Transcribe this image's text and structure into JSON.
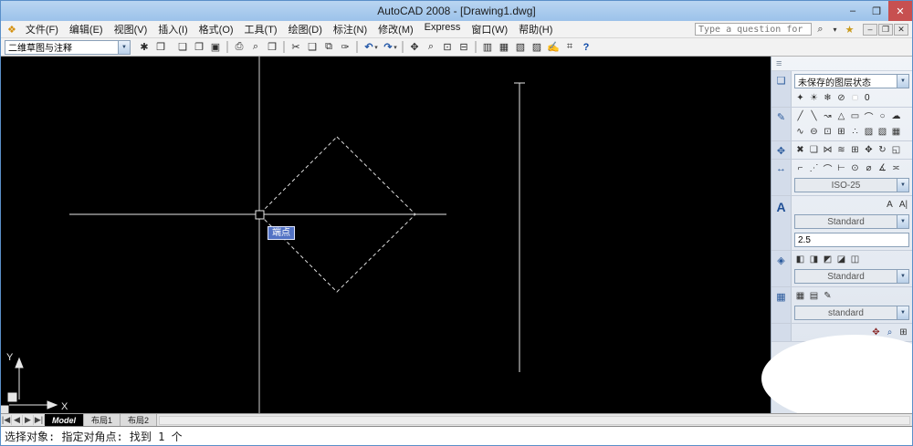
{
  "ui": {
    "caret": "▼",
    "accent_blue": "#9cc2ea",
    "canvas_black": "#000000",
    "tooltip_blue": "#5272c4"
  },
  "window": {
    "title": "AutoCAD 2008 - [Drawing1.dwg]",
    "minimize": "–",
    "restore": "❐",
    "close": "✕"
  },
  "menubar": {
    "acad_icon": "❖",
    "menus": [
      {
        "name": "menu-file",
        "label": "文件(F)"
      },
      {
        "name": "menu-edit",
        "label": "编辑(E)"
      },
      {
        "name": "menu-view",
        "label": "视图(V)"
      },
      {
        "name": "menu-insert",
        "label": "插入(I)"
      },
      {
        "name": "menu-format",
        "label": "格式(O)"
      },
      {
        "name": "menu-tools",
        "label": "工具(T)"
      },
      {
        "name": "menu-draw",
        "label": "绘图(D)"
      },
      {
        "name": "menu-dimension",
        "label": "标注(N)"
      },
      {
        "name": "menu-modify",
        "label": "修改(M)"
      },
      {
        "name": "menu-express",
        "label": "Express"
      },
      {
        "name": "menu-window",
        "label": "窗口(W)"
      },
      {
        "name": "menu-help",
        "label": "帮助(H)"
      }
    ],
    "help_search": {
      "value": "Type a question for help"
    },
    "search_icon": "⌕",
    "search_caret": "▾",
    "star_icon": "★",
    "child_minimize": "–",
    "child_restore": "❐",
    "child_close": "✕"
  },
  "toolbar": {
    "workspace": {
      "value": "二维草图与注释"
    },
    "workspace_icons": [
      {
        "name": "workspace-settings-icon",
        "glyph": "✱"
      },
      {
        "name": "workspace-save-icon",
        "glyph": "❒"
      }
    ],
    "icons": [
      {
        "name": "new-file-icon",
        "glyph": "❏"
      },
      {
        "name": "open-file-icon",
        "glyph": "❐"
      },
      {
        "name": "save-icon",
        "glyph": "▣"
      },
      {
        "name": "toolbar-separator",
        "glyph": ""
      },
      {
        "name": "plot-icon",
        "glyph": "⎙"
      },
      {
        "name": "plot-preview-icon",
        "glyph": "⌕"
      },
      {
        "name": "publish-icon",
        "glyph": "❒"
      },
      {
        "name": "toolbar-separator",
        "glyph": ""
      },
      {
        "name": "cut-icon",
        "glyph": "✂"
      },
      {
        "name": "copy-icon",
        "glyph": "❑"
      },
      {
        "name": "paste-icon",
        "glyph": "⧉"
      },
      {
        "name": "match-properties-icon",
        "glyph": "✑"
      },
      {
        "name": "toolbar-separator",
        "glyph": ""
      },
      {
        "name": "undo-icon",
        "glyph": "↶"
      },
      {
        "name": "undo-caret-icon",
        "glyph": "▾"
      },
      {
        "name": "redo-icon",
        "glyph": "↷"
      },
      {
        "name": "redo-caret-icon",
        "glyph": "▾"
      },
      {
        "name": "toolbar-separator",
        "glyph": ""
      },
      {
        "name": "pan-icon",
        "glyph": "✥"
      },
      {
        "name": "zoom-realtime-icon",
        "glyph": "⌕"
      },
      {
        "name": "zoom-window-icon",
        "glyph": "⊡"
      },
      {
        "name": "zoom-previous-icon",
        "glyph": "⊟"
      },
      {
        "name": "toolbar-separator",
        "glyph": ""
      },
      {
        "name": "properties-icon",
        "glyph": "▥"
      },
      {
        "name": "designcenter-icon",
        "glyph": "▦"
      },
      {
        "name": "toolpalettes-icon",
        "glyph": "▧"
      },
      {
        "name": "sheetset-icon",
        "glyph": "▨"
      },
      {
        "name": "markup-icon",
        "glyph": "✍"
      },
      {
        "name": "quickcalc-icon",
        "glyph": "⌗"
      },
      {
        "name": "help-icon",
        "glyph": "?"
      }
    ]
  },
  "canvas": {
    "tooltip": "端点",
    "ucs_x": "X",
    "ucs_y": "Y"
  },
  "dashboard": {
    "grip_icon": "≡",
    "layers": {
      "icon": "❑",
      "state": "未保存的图层状态",
      "layer_name": "0",
      "tools": [
        {
          "name": "layer-properties-icon",
          "glyph": "✦"
        },
        {
          "name": "layer-on-icon",
          "glyph": "☀"
        },
        {
          "name": "layer-freeze-icon",
          "glyph": "❄"
        },
        {
          "name": "layer-lock-icon",
          "glyph": "⊘"
        },
        {
          "name": "layer-color-icon",
          "glyph": "■"
        }
      ]
    },
    "draw": {
      "icon": "✎",
      "row1": [
        {
          "name": "line-icon",
          "glyph": "╱"
        },
        {
          "name": "construction-line-icon",
          "glyph": "╲"
        },
        {
          "name": "polyline-icon",
          "glyph": "↝"
        },
        {
          "name": "polygon-icon",
          "glyph": "△"
        },
        {
          "name": "rectangle-icon",
          "glyph": "▭"
        },
        {
          "name": "arc-icon",
          "glyph": "⌒"
        },
        {
          "name": "circle-icon",
          "glyph": "○"
        },
        {
          "name": "revision-cloud-icon",
          "glyph": "☁"
        }
      ],
      "row2": [
        {
          "name": "spline-icon",
          "glyph": "∿"
        },
        {
          "name": "ellipse-icon",
          "glyph": "⊖"
        },
        {
          "name": "insert-block-icon",
          "glyph": "⊡"
        },
        {
          "name": "create-block-icon",
          "glyph": "⊞"
        },
        {
          "name": "point-icon",
          "glyph": "∴"
        },
        {
          "name": "hatch-icon",
          "glyph": "▨"
        },
        {
          "name": "gradient-icon",
          "glyph": "▧"
        },
        {
          "name": "region-icon",
          "glyph": "▦"
        }
      ]
    },
    "modify": {
      "icon": "✥",
      "tools": [
        {
          "name": "erase-icon",
          "glyph": "✖"
        },
        {
          "name": "copy-object-icon",
          "glyph": "❏"
        },
        {
          "name": "mirror-icon",
          "glyph": "⋈"
        },
        {
          "name": "offset-icon",
          "glyph": "≋"
        },
        {
          "name": "array-icon",
          "glyph": "⊞"
        },
        {
          "name": "move-icon",
          "glyph": "✥"
        },
        {
          "name": "rotate-icon",
          "glyph": "↻"
        },
        {
          "name": "scale-icon",
          "glyph": "◱"
        }
      ]
    },
    "dimension": {
      "icon": "↔",
      "style": "ISO-25",
      "tools": [
        {
          "name": "linear-dimension-icon",
          "glyph": "⌐"
        },
        {
          "name": "aligned-dimension-icon",
          "glyph": "⋰"
        },
        {
          "name": "arc-length-icon",
          "glyph": "⌒"
        },
        {
          "name": "ordinate-icon",
          "glyph": "⊢"
        },
        {
          "name": "radius-icon",
          "glyph": "⊙"
        },
        {
          "name": "diameter-icon",
          "glyph": "⌀"
        },
        {
          "name": "angular-icon",
          "glyph": "∡"
        },
        {
          "name": "quick-dimension-icon",
          "glyph": "≍"
        }
      ]
    },
    "text": {
      "icon": "A",
      "style": "Standard",
      "height": "2.5",
      "tools": [
        {
          "name": "multiline-text-icon",
          "glyph": "A"
        },
        {
          "name": "single-line-text-icon",
          "glyph": "A|"
        }
      ]
    },
    "attributes": {
      "icon": "◈",
      "style": "Standard",
      "tools": [
        {
          "name": "block-editor-icon",
          "glyph": "◧"
        },
        {
          "name": "define-attribute-icon",
          "glyph": "◨"
        },
        {
          "name": "edit-attribute-icon",
          "glyph": "◩"
        },
        {
          "name": "sync-attributes-icon",
          "glyph": "◪"
        },
        {
          "name": "data-extraction-icon",
          "glyph": "◫"
        }
      ]
    },
    "table": {
      "icon": "▦",
      "style": "standard",
      "tools": [
        {
          "name": "table-icon",
          "glyph": "▦"
        },
        {
          "name": "table-style-icon",
          "glyph": "▤"
        },
        {
          "name": "edit-table-icon",
          "glyph": "✎"
        }
      ]
    },
    "navigation": {
      "tools": [
        {
          "name": "pan-tool-icon",
          "glyph": "✥"
        },
        {
          "name": "zoom-tool-icon",
          "glyph": "⌕"
        },
        {
          "name": "zoom-window-tool-icon",
          "glyph": "⊞"
        }
      ]
    }
  },
  "tabbar": {
    "nav": [
      "|◀",
      "◀",
      "▶",
      "▶|"
    ],
    "tabs": [
      {
        "name": "tab-model",
        "label": "Model",
        "active": true
      },
      {
        "name": "tab-layout1",
        "label": "布局1"
      },
      {
        "name": "tab-layout2",
        "label": "布局2"
      }
    ]
  },
  "command": {
    "prompt": "选择对象: 指定对角点: 找到 1 个"
  }
}
